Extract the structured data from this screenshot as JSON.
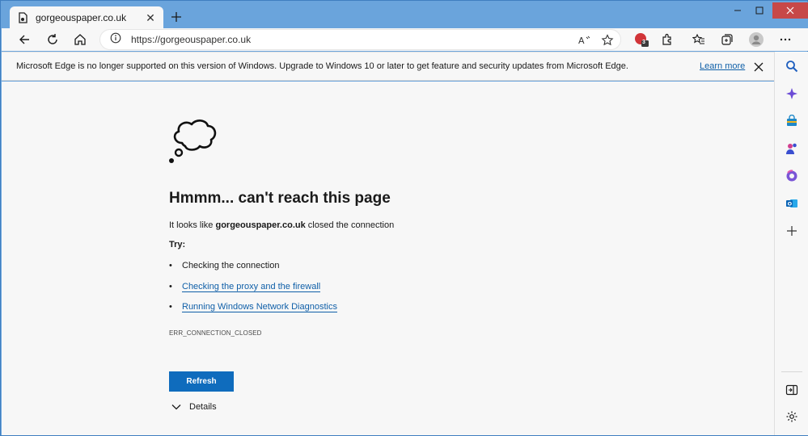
{
  "browser": {
    "tab": {
      "title": "gorgeouspaper.co.uk",
      "close_glyph": "✕",
      "favicon": "broken-page-icon"
    },
    "new_tab_icon": "plus-icon",
    "window_controls": [
      "minimize-icon",
      "maximize-icon",
      "close-icon"
    ],
    "address": {
      "url": "https://gorgeouspaper.co.uk"
    },
    "extension_badge": "3",
    "accent_color": "#0f6cbd"
  },
  "infobar": {
    "message": "Microsoft Edge is no longer supported on this version of Windows. Upgrade to Windows 10 or later to get feature and security updates from Microsoft Edge.",
    "link": "Learn more"
  },
  "error_page": {
    "title": "Hmmm... can't reach this page",
    "desc_prefix": "It looks like ",
    "desc_host": "gorgeouspaper.co.uk",
    "desc_suffix": " closed the connection",
    "try_label": "Try:",
    "tips": [
      {
        "text": "Checking the connection",
        "link": false
      },
      {
        "text": "Checking the proxy and the firewall",
        "link": true
      },
      {
        "text": "Running Windows Network Diagnostics",
        "link": true
      }
    ],
    "error_code": "ERR_CONNECTION_CLOSED",
    "refresh_label": "Refresh",
    "details_label": "Details"
  },
  "sidebar": {
    "icons": [
      "search-icon",
      "copilot-icon",
      "shopping-icon",
      "games-icon",
      "office-icon",
      "outlook-icon",
      "add-icon",
      "hide-sidebar-icon",
      "settings-icon"
    ]
  }
}
